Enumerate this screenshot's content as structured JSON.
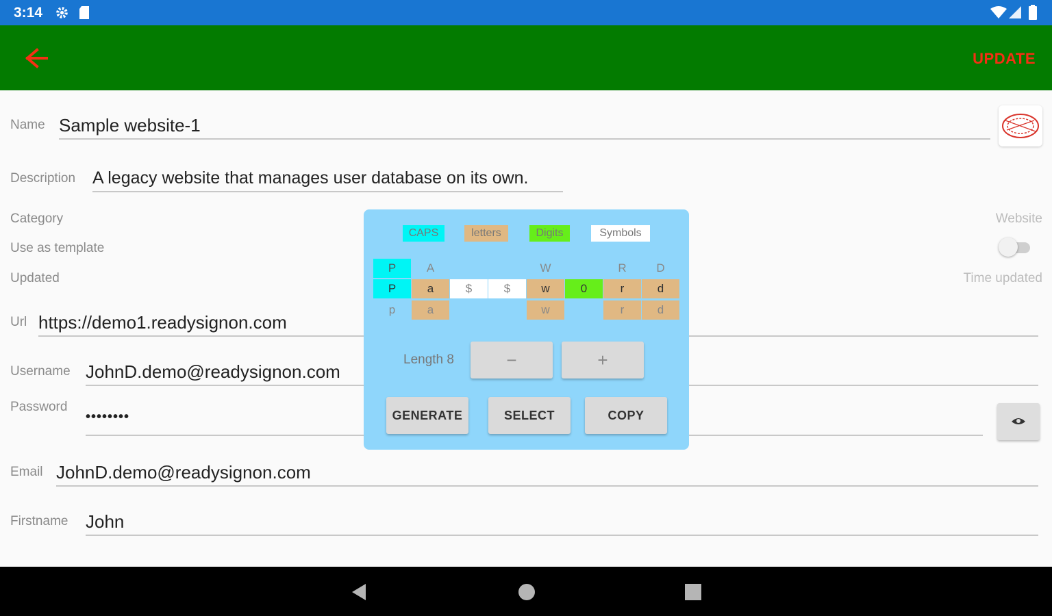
{
  "status_bar": {
    "time": "3:14",
    "icons_left": [
      "gear-icon",
      "sd-card-icon"
    ],
    "icons_right": [
      "wifi-icon",
      "signal-icon",
      "battery-icon"
    ]
  },
  "app_bar": {
    "back_icon": "arrow-left-icon",
    "update_label": "UPDATE",
    "background": "#037b00",
    "accent": "#f52f14"
  },
  "form": {
    "name_label": "Name",
    "name_value": "Sample website-1",
    "description_label": "Description",
    "description_value": "A legacy website that manages user database on its own.",
    "category_label": "Category",
    "category_value": "Website",
    "template_label": "Use as template",
    "template_enabled": false,
    "updated_label": "Updated",
    "updated_value": "Time updated",
    "url_label": "Url",
    "url_value": "https://demo1.readysignon.com",
    "username_label": "Username",
    "username_value": "JohnD.demo@readysignon.com",
    "password_label": "Password",
    "password_value": "••••••••",
    "email_label": "Email",
    "email_value": "JohnD.demo@readysignon.com",
    "firstname_label": "Firstname",
    "firstname_value": "John"
  },
  "generator": {
    "legend": [
      {
        "label": "CAPS",
        "color": "#00f5f5"
      },
      {
        "label": "letters",
        "color": "#e0b883"
      },
      {
        "label": "Digits",
        "color": "#66ee1a"
      },
      {
        "label": "Symbols",
        "color": "#ffffff"
      }
    ],
    "upper_row": [
      "P",
      "A",
      "",
      "",
      "W",
      "",
      "R",
      "D"
    ],
    "main_row": [
      "P",
      "a",
      "$",
      "$",
      "w",
      "0",
      "r",
      "d"
    ],
    "main_types": [
      "caps",
      "letter",
      "symbol",
      "symbol",
      "letter",
      "digit",
      "letter",
      "letter"
    ],
    "lower_row": [
      "p",
      "a",
      "",
      "",
      "w",
      "",
      "r",
      "d"
    ],
    "length_label": "Length 8",
    "minus_label": "−",
    "plus_label": "+",
    "generate_label": "GENERATE",
    "select_label": "SELECT",
    "copy_label": "COPY"
  }
}
